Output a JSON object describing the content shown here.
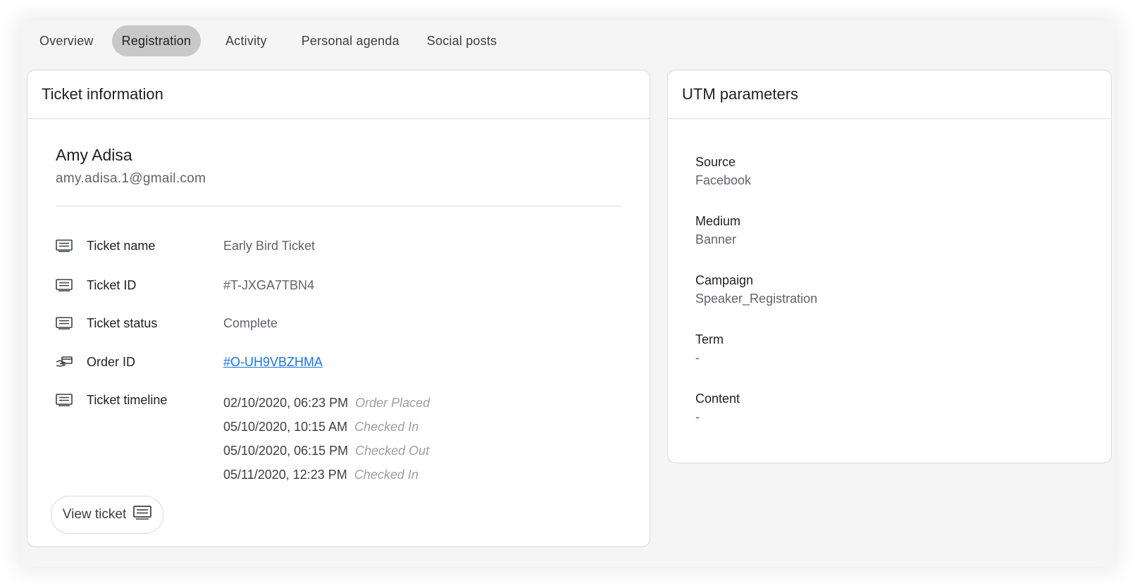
{
  "tabs": [
    "Overview",
    "Registration",
    "Activity",
    "Personal agenda",
    "Social posts"
  ],
  "active_tab": "Registration",
  "ticket_card": {
    "title": "Ticket information",
    "attendee_name": "Amy Adisa",
    "attendee_email": "amy.adisa.1@gmail.com",
    "fields": [
      {
        "label": "Ticket name",
        "value": "Early Bird Ticket",
        "icon": "ticket-icon"
      },
      {
        "label": "Ticket ID",
        "value": "#T-JXGA7TBN4",
        "icon": "ticket-icon"
      },
      {
        "label": "Ticket status",
        "value": "Complete",
        "icon": "ticket-icon"
      },
      {
        "label": "Order ID",
        "value": "#O-UH9VBZHMA",
        "icon": "hand-card-icon",
        "link_color": "#1a73e8"
      },
      {
        "label": "Ticket timeline",
        "icon": "ticket-icon"
      }
    ],
    "timeline": [
      {
        "date": "02/10/2020, 06:23 PM",
        "status": "Order Placed"
      },
      {
        "date": "05/10/2020, 10:15 AM",
        "status": "Checked In"
      },
      {
        "date": "05/10/2020, 06:15 PM",
        "status": "Checked Out"
      },
      {
        "date": "05/11/2020, 12:23 PM",
        "status": "Checked In"
      }
    ],
    "view_button_label": "View ticket"
  },
  "utm_card": {
    "title": "UTM parameters",
    "items": [
      {
        "label": "Source",
        "value": "Facebook"
      },
      {
        "label": "Medium",
        "value": "Banner"
      },
      {
        "label": "Campaign",
        "value": "Speaker_Registration"
      },
      {
        "label": "Term",
        "value": "-"
      },
      {
        "label": "Content",
        "value": "-"
      }
    ]
  },
  "colors": {
    "active_tab_bg": "#c8c8c8",
    "link": "#1a73e8",
    "page_bg": "#f5f5f5"
  }
}
